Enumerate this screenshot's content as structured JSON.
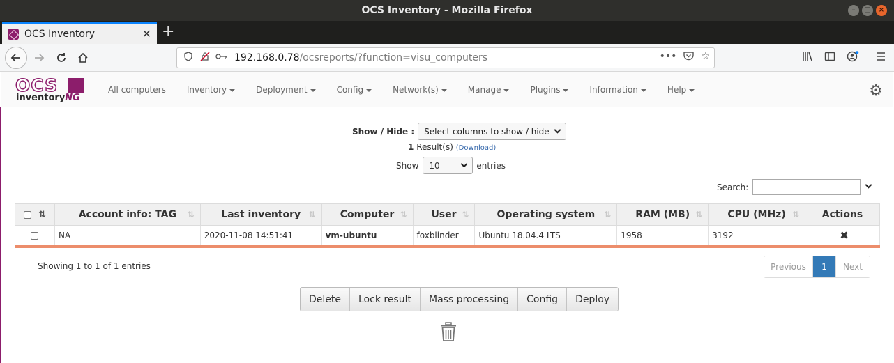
{
  "window": {
    "title": "OCS Inventory - Mozilla Firefox"
  },
  "browser": {
    "tab_title": "OCS Inventory",
    "url_host": "192.168.0.78",
    "url_path": "/ocsreports/?function=visu_computers"
  },
  "app": {
    "logo_ocs": "OCS",
    "logo_inventory": "inventory",
    "logo_ng": "NG",
    "menu": [
      {
        "label": "All computers"
      },
      {
        "label": "Inventory"
      },
      {
        "label": "Deployment"
      },
      {
        "label": "Config"
      },
      {
        "label": "Network(s)"
      },
      {
        "label": "Manage"
      },
      {
        "label": "Plugins"
      },
      {
        "label": "Information"
      },
      {
        "label": "Help"
      }
    ]
  },
  "toolbar": {
    "showhide_label": "Show / Hide :",
    "columns_select": "Select columns to show / hide",
    "results_count": "1",
    "results_label": "Result(s)",
    "download_label": "(Download)",
    "show_label": "Show",
    "entries_value": "10",
    "entries_label": "entries",
    "search_label": "Search:"
  },
  "table": {
    "headers": [
      "Account info: TAG",
      "Last inventory",
      "Computer",
      "User",
      "Operating system",
      "RAM (MB)",
      "CPU (MHz)",
      "Actions"
    ],
    "rows": [
      {
        "tag": "NA",
        "last_inventory": "2020-11-08 14:51:41",
        "computer": "vm-ubuntu",
        "user": "foxblinder",
        "os": "Ubuntu 18.04.4 LTS",
        "ram": "1958",
        "cpu": "3192"
      }
    ]
  },
  "footer": {
    "info": "Showing 1 to 1 of 1 entries",
    "previous": "Previous",
    "page": "1",
    "next": "Next"
  },
  "actions": {
    "delete": "Delete",
    "lock": "Lock result",
    "mass": "Mass processing",
    "config": "Config",
    "deploy": "Deploy"
  },
  "colors": {
    "brand": "#8c1d6b",
    "pager_active": "#337ab7",
    "row_underline": "#ec8d6b"
  }
}
